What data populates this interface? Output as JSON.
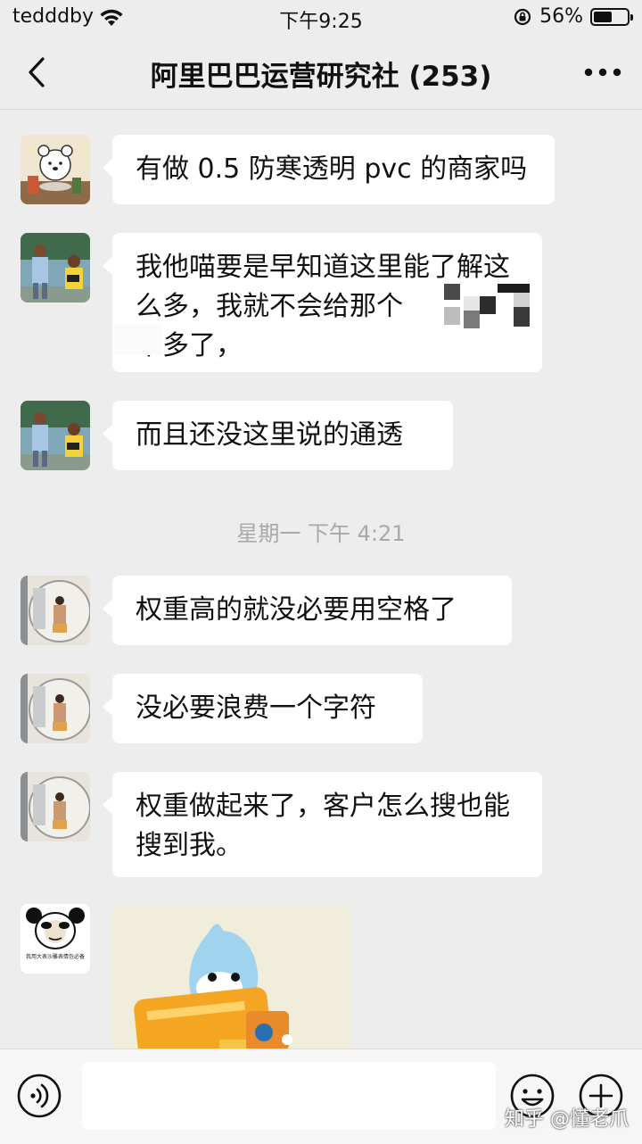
{
  "status_bar": {
    "carrier": "tedddby",
    "time": "下午9:25",
    "battery": "56%",
    "battery_level": 0.56
  },
  "nav": {
    "title": "阿里巴巴运营研究社 (253)",
    "back_icon": "chevron-left-icon",
    "more_icon": "more-dots-icon"
  },
  "messages": [
    {
      "text": "有做 0.5 防寒透明 pvc 的商家吗"
    },
    {
      "text": "我他喵要是早知道这里能了解这么多，我就不会给那个　　 交 5 千多了，"
    },
    {
      "text": "而且还没这里说的通透"
    },
    {
      "text": "权重高的就没必要用空格了"
    },
    {
      "text": "没必要浪费一个字符"
    },
    {
      "text": "权重做起来了，客户怎么搜也能搜到我。"
    }
  ],
  "timestamp": "星期一 下午 4:21",
  "sticker_avatar_caption": "我用大表沙雕表情包必备",
  "input_bar": {
    "placeholder": "",
    "voice_icon": "voice-icon",
    "emoji_icon": "emoji-icon",
    "plus_icon": "plus-icon"
  },
  "watermark": "知乎 @懂老爪"
}
